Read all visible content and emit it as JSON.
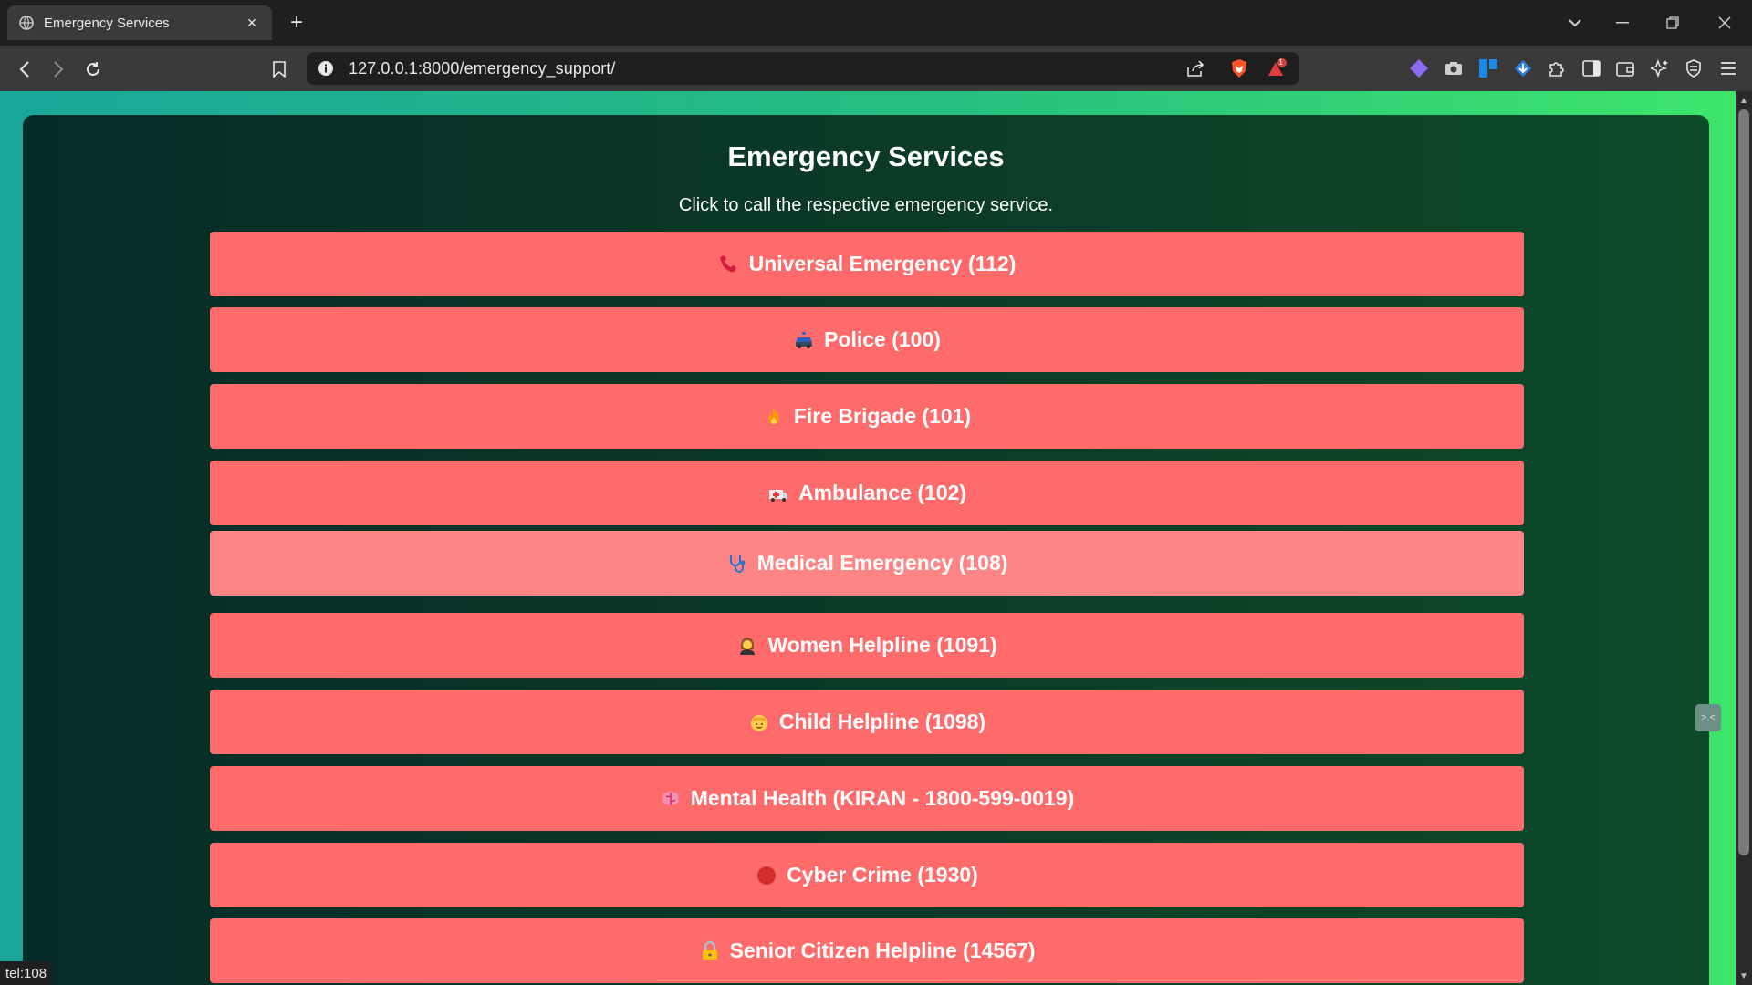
{
  "browser": {
    "tab": {
      "title": "Emergency Services"
    },
    "url": "127.0.0.1:8000/emergency_support/",
    "shields_badge": "1",
    "status_text": "tel:108"
  },
  "page": {
    "title": "Emergency Services",
    "subtitle": "Click to call the respective emergency service.",
    "services": [
      {
        "icon": "telephone-receiver-icon",
        "label": "Universal Emergency (112)"
      },
      {
        "icon": "police-car-icon",
        "label": "Police (100)"
      },
      {
        "icon": "fire-icon",
        "label": "Fire Brigade (101)"
      },
      {
        "icon": "ambulance-icon",
        "label": "Ambulance (102)"
      },
      {
        "icon": "stethoscope-icon",
        "label": "Medical Emergency (108)",
        "state": "hover"
      },
      {
        "icon": "woman-icon",
        "label": "Women Helpline (1091)"
      },
      {
        "icon": "child-icon",
        "label": "Child Helpline (1098)"
      },
      {
        "icon": "brain-icon",
        "label": "Mental Health (KIRAN - 1800-599-0019)"
      },
      {
        "icon": "red-circle-icon",
        "label": "Cyber Crime (1930)"
      },
      {
        "icon": "lock-icon",
        "label": "Senior Citizen Helpline (14567)"
      }
    ]
  },
  "colors": {
    "button": "#ff6b6b",
    "button_hover": "#ff8585",
    "background_gradient_start": "#1aa69a",
    "background_gradient_end": "#3ee66a",
    "card": "#0b3a27"
  }
}
